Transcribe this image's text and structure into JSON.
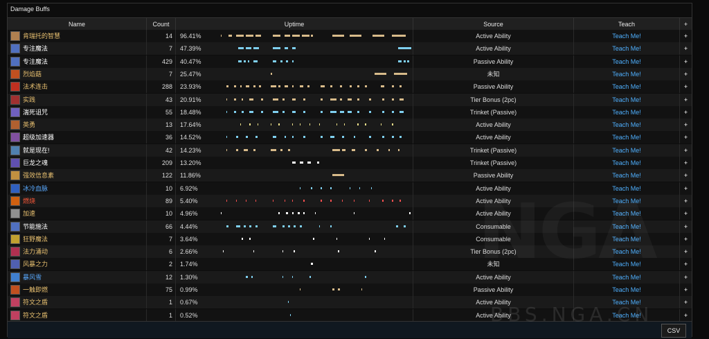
{
  "panel_title": "Damage Buffs",
  "headers": {
    "name": "Name",
    "count": "Count",
    "uptime": "Uptime",
    "source": "Source",
    "teach": "Teach",
    "plus": "+"
  },
  "teach_label": "Teach Me!",
  "plus_label": "+",
  "csv_label": "CSV",
  "watermark": "NGA",
  "watermark_url": "BBS.NGA.CN",
  "rows": [
    {
      "name": "肯瑞托的智慧",
      "count": "14",
      "uptime": "96.41%",
      "source": "Active Ability",
      "name_color": "#e8c070",
      "icon": "#b08050",
      "bar": "#d8bb8a",
      "segs": [
        [
          0.01,
          0.005
        ],
        [
          0.05,
          0.02
        ],
        [
          0.09,
          0.04
        ],
        [
          0.14,
          0.04
        ],
        [
          0.19,
          0.03
        ],
        [
          0.28,
          0.04
        ],
        [
          0.34,
          0.03
        ],
        [
          0.38,
          0.04
        ],
        [
          0.43,
          0.04
        ],
        [
          0.48,
          0.01
        ],
        [
          0.59,
          0.06
        ],
        [
          0.68,
          0.06
        ],
        [
          0.8,
          0.06
        ],
        [
          0.9,
          0.07
        ]
      ]
    },
    {
      "name": "专注魔法",
      "count": "7",
      "uptime": "47.39%",
      "source": "Active Ability",
      "name_color": "#ffffff",
      "icon": "#5070c0",
      "bar": "#7fd0f0",
      "segs": [
        [
          0.1,
          0.03
        ],
        [
          0.14,
          0.03
        ],
        [
          0.18,
          0.03
        ],
        [
          0.28,
          0.04
        ],
        [
          0.34,
          0.02
        ],
        [
          0.38,
          0.02
        ],
        [
          0.93,
          0.07
        ]
      ]
    },
    {
      "name": "专注魔法",
      "count": "429",
      "uptime": "40.47%",
      "source": "Passive Ability",
      "name_color": "#ffffff",
      "icon": "#5070c0",
      "bar": "#7fd0f0",
      "segs": [
        [
          0.1,
          0.02
        ],
        [
          0.13,
          0.01
        ],
        [
          0.15,
          0.01
        ],
        [
          0.18,
          0.02
        ],
        [
          0.28,
          0.02
        ],
        [
          0.32,
          0.01
        ],
        [
          0.35,
          0.01
        ],
        [
          0.38,
          0.01
        ],
        [
          0.93,
          0.02
        ],
        [
          0.96,
          0.01
        ],
        [
          0.98,
          0.01
        ]
      ]
    },
    {
      "name": "烈焰菇",
      "count": "7",
      "uptime": "25.47%",
      "source": "未知",
      "name_color": "#e8c070",
      "icon": "#c05020",
      "bar": "#d8bb8a",
      "segs": [
        [
          0.27,
          0.006
        ],
        [
          0.81,
          0.06
        ],
        [
          0.91,
          0.07
        ]
      ]
    },
    {
      "name": "法术连击",
      "count": "288",
      "uptime": "23.93%",
      "source": "Passive Ability",
      "name_color": "#e8c070",
      "icon": "#c03020",
      "bar": "#d8bb8a",
      "segs": [
        [
          0.04,
          0.01
        ],
        [
          0.08,
          0.01
        ],
        [
          0.11,
          0.01
        ],
        [
          0.14,
          0.02
        ],
        [
          0.18,
          0.01
        ],
        [
          0.21,
          0.01
        ],
        [
          0.27,
          0.03
        ],
        [
          0.31,
          0.01
        ],
        [
          0.34,
          0.02
        ],
        [
          0.38,
          0.01
        ],
        [
          0.42,
          0.02
        ],
        [
          0.46,
          0.01
        ],
        [
          0.53,
          0.02
        ],
        [
          0.58,
          0.01
        ],
        [
          0.63,
          0.01
        ],
        [
          0.68,
          0.01
        ],
        [
          0.72,
          0.01
        ],
        [
          0.76,
          0.01
        ],
        [
          0.84,
          0.02
        ],
        [
          0.9,
          0.01
        ],
        [
          0.94,
          0.01
        ]
      ]
    },
    {
      "name": "实践",
      "count": "43",
      "uptime": "20.91%",
      "source": "Tier Bonus (2pc)",
      "name_color": "#e8c070",
      "icon": "#a03030",
      "bar": "#d8bb8a",
      "segs": [
        [
          0.04,
          0.005
        ],
        [
          0.08,
          0.01
        ],
        [
          0.12,
          0.005
        ],
        [
          0.16,
          0.02
        ],
        [
          0.22,
          0.01
        ],
        [
          0.28,
          0.03
        ],
        [
          0.33,
          0.01
        ],
        [
          0.38,
          0.02
        ],
        [
          0.44,
          0.01
        ],
        [
          0.53,
          0.01
        ],
        [
          0.58,
          0.03
        ],
        [
          0.63,
          0.01
        ],
        [
          0.67,
          0.02
        ],
        [
          0.72,
          0.01
        ],
        [
          0.78,
          0.01
        ],
        [
          0.85,
          0.01
        ],
        [
          0.9,
          0.01
        ],
        [
          0.94,
          0.02
        ]
      ]
    },
    {
      "name": "湍死诅咒",
      "count": "55",
      "uptime": "18.48%",
      "source": "Trinket (Passive)",
      "name_color": "#ffffff",
      "icon": "#7060c0",
      "bar": "#7fd0f0",
      "segs": [
        [
          0.04,
          0.005
        ],
        [
          0.08,
          0.01
        ],
        [
          0.12,
          0.01
        ],
        [
          0.16,
          0.02
        ],
        [
          0.22,
          0.01
        ],
        [
          0.28,
          0.03
        ],
        [
          0.33,
          0.01
        ],
        [
          0.38,
          0.02
        ],
        [
          0.44,
          0.01
        ],
        [
          0.53,
          0.01
        ],
        [
          0.58,
          0.03
        ],
        [
          0.63,
          0.02
        ],
        [
          0.67,
          0.02
        ],
        [
          0.72,
          0.01
        ],
        [
          0.78,
          0.01
        ],
        [
          0.85,
          0.01
        ],
        [
          0.9,
          0.01
        ],
        [
          0.94,
          0.02
        ]
      ]
    },
    {
      "name": "英勇",
      "count": "13",
      "uptime": "17.64%",
      "source": "Active Ability",
      "name_color": "#e8c070",
      "icon": "#b06030",
      "bar": "#f0e08a",
      "segs": [
        [
          0.11,
          0.005
        ],
        [
          0.16,
          0.005
        ],
        [
          0.2,
          0.005
        ],
        [
          0.27,
          0.005
        ],
        [
          0.31,
          0.005
        ],
        [
          0.38,
          0.005
        ],
        [
          0.42,
          0.005
        ],
        [
          0.47,
          0.005
        ],
        [
          0.52,
          0.005
        ],
        [
          0.61,
          0.005
        ],
        [
          0.65,
          0.005
        ],
        [
          0.72,
          0.005
        ],
        [
          0.76,
          0.005
        ],
        [
          0.84,
          0.005
        ],
        [
          0.9,
          0.005
        ]
      ]
    },
    {
      "name": "超级加速器",
      "count": "36",
      "uptime": "14.52%",
      "source": "Active Ability",
      "name_color": "#ffffff",
      "icon": "#8050a0",
      "bar": "#7fd0f0",
      "segs": [
        [
          0.04,
          0.005
        ],
        [
          0.09,
          0.01
        ],
        [
          0.14,
          0.01
        ],
        [
          0.19,
          0.01
        ],
        [
          0.28,
          0.02
        ],
        [
          0.34,
          0.01
        ],
        [
          0.38,
          0.01
        ],
        [
          0.44,
          0.01
        ],
        [
          0.53,
          0.01
        ],
        [
          0.58,
          0.02
        ],
        [
          0.64,
          0.01
        ],
        [
          0.7,
          0.01
        ],
        [
          0.78,
          0.01
        ],
        [
          0.85,
          0.01
        ],
        [
          0.9,
          0.01
        ],
        [
          0.94,
          0.01
        ]
      ]
    },
    {
      "name": "就是现在!",
      "count": "42",
      "uptime": "14.23%",
      "source": "Trinket (Passive)",
      "name_color": "#ffffff",
      "icon": "#5080b0",
      "bar": "#d8bb8a",
      "segs": [
        [
          0.04,
          0.005
        ],
        [
          0.09,
          0.01
        ],
        [
          0.13,
          0.02
        ],
        [
          0.18,
          0.01
        ],
        [
          0.27,
          0.03
        ],
        [
          0.32,
          0.01
        ],
        [
          0.36,
          0.01
        ],
        [
          0.59,
          0.04
        ],
        [
          0.64,
          0.02
        ],
        [
          0.69,
          0.02
        ],
        [
          0.76,
          0.01
        ],
        [
          0.82,
          0.01
        ],
        [
          0.88,
          0.01
        ],
        [
          0.93,
          0.01
        ]
      ]
    },
    {
      "name": "巨龙之魂",
      "count": "209",
      "uptime": "13.20%",
      "source": "Trinket (Passive)",
      "name_color": "#ffffff",
      "icon": "#6050b0",
      "bar": "#ffffff",
      "segs": [
        [
          0.38,
          0.02
        ],
        [
          0.42,
          0.02
        ],
        [
          0.46,
          0.02
        ],
        [
          0.51,
          0.01
        ]
      ]
    },
    {
      "name": "强效信息素",
      "count": "122",
      "uptime": "11.86%",
      "source": "Passive Ability",
      "name_color": "#e8c070",
      "icon": "#c09040",
      "bar": "#d8bb8a",
      "segs": [
        [
          0.59,
          0.06
        ]
      ]
    },
    {
      "name": "冰冷血脉",
      "count": "10",
      "uptime": "6.92%",
      "source": "Active Ability",
      "name_color": "#5aaaff",
      "icon": "#3060c0",
      "bar": "#7fd0f0",
      "segs": [
        [
          0.42,
          0.005
        ],
        [
          0.48,
          0.005
        ],
        [
          0.53,
          0.005
        ],
        [
          0.58,
          0.005
        ],
        [
          0.68,
          0.005
        ],
        [
          0.73,
          0.005
        ],
        [
          0.79,
          0.005
        ]
      ]
    },
    {
      "name": "燃烧",
      "count": "89",
      "uptime": "5.40%",
      "source": "Active Ability",
      "name_color": "#ff5a3a",
      "icon": "#d06010",
      "bar": "#ff5050",
      "segs": [
        [
          0.04,
          0.005
        ],
        [
          0.09,
          0.005
        ],
        [
          0.14,
          0.005
        ],
        [
          0.19,
          0.005
        ],
        [
          0.28,
          0.005
        ],
        [
          0.34,
          0.005
        ],
        [
          0.38,
          0.005
        ],
        [
          0.44,
          0.005
        ],
        [
          0.53,
          0.005
        ],
        [
          0.58,
          0.005
        ],
        [
          0.64,
          0.005
        ],
        [
          0.7,
          0.005
        ],
        [
          0.78,
          0.005
        ],
        [
          0.85,
          0.005
        ],
        [
          0.9,
          0.005
        ],
        [
          0.94,
          0.005
        ]
      ]
    },
    {
      "name": "加速",
      "count": "10",
      "uptime": "4.96%",
      "source": "Active Ability",
      "name_color": "#e8c070",
      "icon": "#909090",
      "bar": "#ffffff",
      "segs": [
        [
          0.01,
          0.005
        ],
        [
          0.31,
          0.005
        ],
        [
          0.35,
          0.01
        ],
        [
          0.38,
          0.01
        ],
        [
          0.41,
          0.01
        ],
        [
          0.44,
          0.005
        ],
        [
          0.5,
          0.005
        ],
        [
          0.7,
          0.005
        ],
        [
          0.99,
          0.005
        ]
      ]
    },
    {
      "name": "节能施法",
      "count": "66",
      "uptime": "4.44%",
      "source": "Consumable",
      "name_color": "#ffffff",
      "icon": "#5070c0",
      "bar": "#7fd0f0",
      "segs": [
        [
          0.04,
          0.01
        ],
        [
          0.09,
          0.02
        ],
        [
          0.13,
          0.01
        ],
        [
          0.16,
          0.01
        ],
        [
          0.19,
          0.01
        ],
        [
          0.28,
          0.02
        ],
        [
          0.33,
          0.01
        ],
        [
          0.36,
          0.01
        ],
        [
          0.39,
          0.01
        ],
        [
          0.42,
          0.01
        ],
        [
          0.52,
          0.005
        ],
        [
          0.58,
          0.005
        ],
        [
          0.92,
          0.01
        ],
        [
          0.96,
          0.01
        ]
      ]
    },
    {
      "name": "狂野魔法",
      "count": "7",
      "uptime": "3.64%",
      "source": "Consumable",
      "name_color": "#e8c070",
      "icon": "#c0a030",
      "bar": "#ffffff",
      "segs": [
        [
          0.12,
          0.005
        ],
        [
          0.16,
          0.005
        ],
        [
          0.49,
          0.005
        ],
        [
          0.61,
          0.005
        ],
        [
          0.78,
          0.005
        ],
        [
          0.86,
          0.005
        ]
      ]
    },
    {
      "name": "法力涌动",
      "count": "6",
      "uptime": "2.66%",
      "source": "Tier Bonus (2pc)",
      "name_color": "#e8c070",
      "icon": "#b03050",
      "bar": "#ffffff",
      "segs": [
        [
          0.02,
          0.005
        ],
        [
          0.18,
          0.005
        ],
        [
          0.33,
          0.005
        ],
        [
          0.39,
          0.005
        ],
        [
          0.62,
          0.005
        ],
        [
          0.81,
          0.005
        ]
      ]
    },
    {
      "name": "风暴之力",
      "count": "2",
      "uptime": "1.74%",
      "source": "未知",
      "name_color": "#e8c070",
      "icon": "#5060b0",
      "bar": "#ffffff",
      "segs": [
        [
          0.48,
          0.01
        ]
      ]
    },
    {
      "name": "暴风雪",
      "count": "12",
      "uptime": "1.30%",
      "source": "Active Ability",
      "name_color": "#5aaaff",
      "icon": "#4080d0",
      "bar": "#7fd0f0",
      "segs": [
        [
          0.14,
          0.01
        ],
        [
          0.17,
          0.005
        ],
        [
          0.33,
          0.005
        ],
        [
          0.38,
          0.005
        ],
        [
          0.47,
          0.01
        ],
        [
          0.76,
          0.005
        ]
      ]
    },
    {
      "name": "一触即燃",
      "count": "75",
      "uptime": "0.99%",
      "source": "Passive Ability",
      "name_color": "#e8c070",
      "icon": "#c05020",
      "bar": "#d8bb8a",
      "segs": [
        [
          0.42,
          0.005
        ],
        [
          0.59,
          0.01
        ],
        [
          0.62,
          0.01
        ],
        [
          0.74,
          0.005
        ]
      ]
    },
    {
      "name": "符文之盾",
      "count": "1",
      "uptime": "0.67%",
      "source": "Active Ability",
      "name_color": "#e8c070",
      "icon": "#c04060",
      "bar": "#7fd0f0",
      "segs": [
        [
          0.36,
          0.005
        ]
      ]
    },
    {
      "name": "符文之盾",
      "count": "1",
      "uptime": "0.52%",
      "source": "Active Ability",
      "name_color": "#e8c070",
      "icon": "#c04060",
      "bar": "#7fd0f0",
      "segs": [
        [
          0.37,
          0.005
        ]
      ]
    }
  ]
}
